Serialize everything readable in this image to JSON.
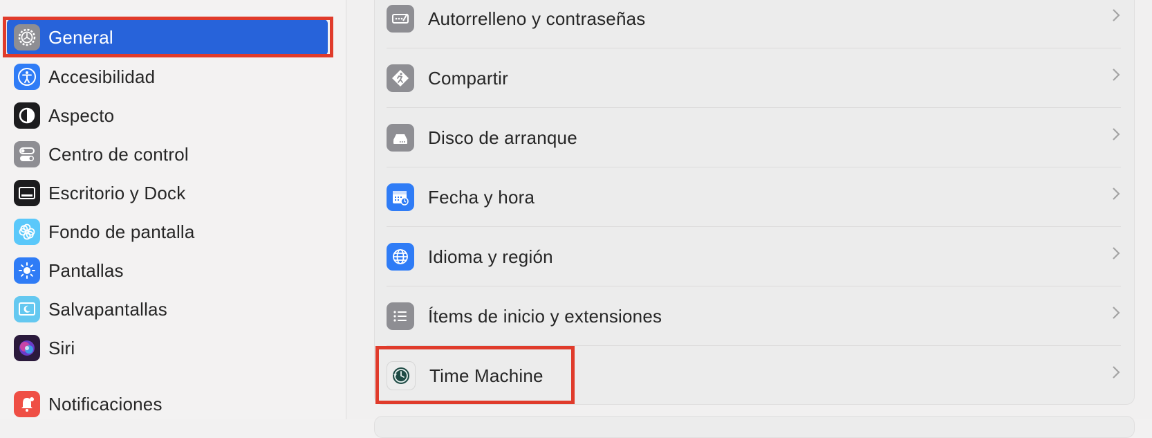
{
  "sidebar": {
    "items": [
      {
        "label": "General",
        "icon": "gear-icon"
      },
      {
        "label": "Accesibilidad",
        "icon": "accessibility-icon"
      },
      {
        "label": "Aspecto",
        "icon": "appearance-icon"
      },
      {
        "label": "Centro de control",
        "icon": "control-center-icon"
      },
      {
        "label": "Escritorio y Dock",
        "icon": "dock-icon"
      },
      {
        "label": "Fondo de pantalla",
        "icon": "wallpaper-icon"
      },
      {
        "label": "Pantallas",
        "icon": "displays-icon"
      },
      {
        "label": "Salvapantallas",
        "icon": "screensaver-icon"
      },
      {
        "label": "Siri",
        "icon": "siri-icon"
      },
      {
        "label": "Notificaciones",
        "icon": "notifications-icon"
      }
    ],
    "selected": "General"
  },
  "main": {
    "rows": [
      {
        "label": "Autorrelleno y contraseñas",
        "icon": "autofill-icon"
      },
      {
        "label": "Compartir",
        "icon": "sharing-icon"
      },
      {
        "label": "Disco de arranque",
        "icon": "startup-disk-icon"
      },
      {
        "label": "Fecha y hora",
        "icon": "calendar-clock-icon"
      },
      {
        "label": "Idioma y región",
        "icon": "globe-icon"
      },
      {
        "label": "Ítems de inicio y extensiones",
        "icon": "list-icon"
      },
      {
        "label": "Time Machine",
        "icon": "time-machine-icon"
      }
    ]
  },
  "colors": {
    "selection": "#2763da",
    "highlight": "#e03b2b"
  }
}
